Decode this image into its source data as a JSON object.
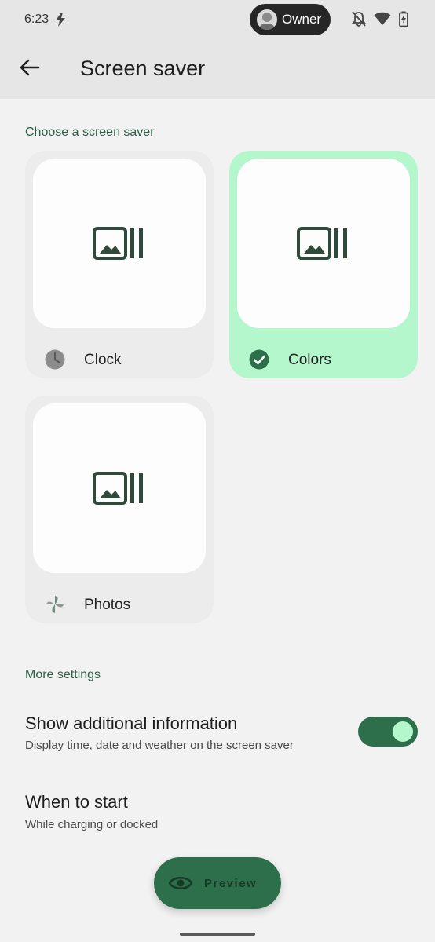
{
  "status_bar": {
    "time": "6:23",
    "owner_label": "Owner",
    "icons": [
      "charging-bolt-icon",
      "notifications-off-icon",
      "wifi-icon",
      "battery-charging-icon"
    ]
  },
  "app_bar": {
    "title": "Screen saver",
    "back_icon": "arrow-left-icon"
  },
  "choose_section": {
    "header": "Choose a screen saver",
    "options": [
      {
        "label": "Clock",
        "icon": "clock-icon",
        "selected": false
      },
      {
        "label": "Colors",
        "icon": "check-circle-icon",
        "selected": true
      },
      {
        "label": "Photos",
        "icon": "pinwheel-icon",
        "selected": false
      }
    ]
  },
  "more_settings": {
    "header": "More settings",
    "show_additional": {
      "title": "Show additional information",
      "subtitle": "Display time, date and weather on the screen saver",
      "enabled": true
    },
    "when_to_start": {
      "title": "When to start",
      "subtitle": "While charging or docked"
    }
  },
  "preview_button": {
    "label": "Preview",
    "icon": "eye-icon"
  },
  "colors": {
    "accent": "#2e6f4b",
    "selected_card": "#b4f7cc",
    "header_text": "#2d5f44"
  }
}
